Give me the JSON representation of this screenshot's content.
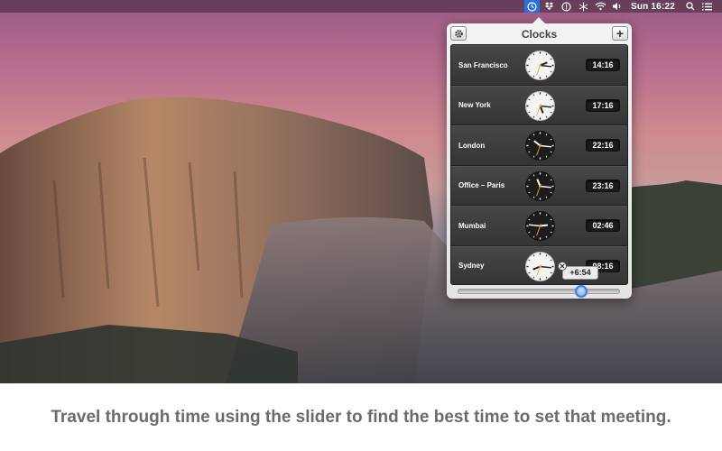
{
  "menubar": {
    "time": "Sun 16:22",
    "icons": [
      "clock-icon",
      "dropbox-icon",
      "info-icon",
      "snowflake-icon",
      "wifi-icon",
      "volume-icon",
      "search-icon",
      "list-icon"
    ]
  },
  "popover": {
    "title": "Clocks",
    "add_label": "+",
    "clocks": [
      {
        "city": "San Francisco",
        "time": "14:16",
        "theme": "light"
      },
      {
        "city": "New York",
        "time": "17:16",
        "theme": "light"
      },
      {
        "city": "London",
        "time": "22:16",
        "theme": "dark"
      },
      {
        "city": "Office – Paris",
        "time": "23:16",
        "theme": "dark"
      },
      {
        "city": "Mumbai",
        "time": "02:46",
        "theme": "dark"
      },
      {
        "city": "Sydney",
        "time": "08:16",
        "theme": "light"
      }
    ],
    "slider": {
      "offset_label": "+6:54"
    }
  },
  "caption": "Travel through time using the slider to find the best time to set that meeting.",
  "colors": {
    "accent": "#2d6fd8",
    "seconds_hand": "#f5a623"
  }
}
